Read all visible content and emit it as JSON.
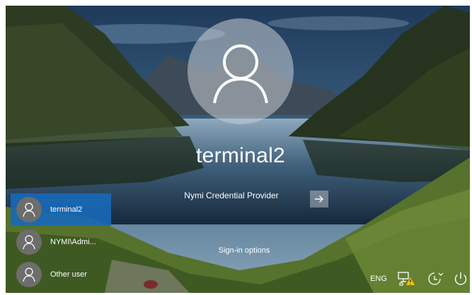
{
  "login": {
    "username": "terminal2",
    "credential_provider": "Nymi Credential Provider",
    "submit_icon": "arrow-right-icon",
    "sign_in_options": "Sign-in options"
  },
  "users": [
    {
      "name": "terminal2",
      "selected": true
    },
    {
      "name": "NYMI\\Admi...",
      "selected": false
    },
    {
      "name": "Other user",
      "selected": false
    }
  ],
  "tray": {
    "language": "ENG",
    "network_icon": "network-warning-icon",
    "accessibility_icon": "ease-of-access-icon",
    "power_icon": "power-icon"
  },
  "colors": {
    "selected_tile": "#1868b6",
    "text": "#ffffff",
    "warning": "#f2c500"
  }
}
